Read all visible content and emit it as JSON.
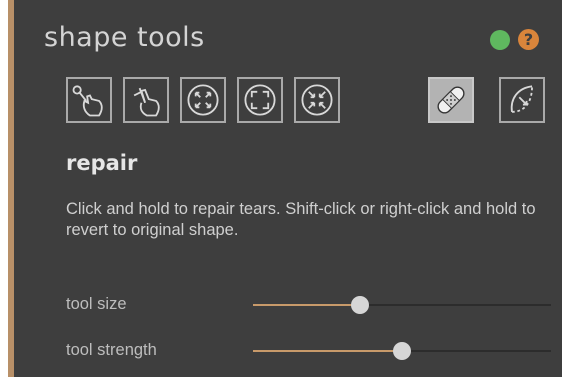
{
  "panel": {
    "title": "shape tools",
    "status_color": "#5fb85f",
    "help_icon": "?",
    "accent_color": "#b89068"
  },
  "tools": [
    {
      "name": "pull-tool-icon",
      "active": false
    },
    {
      "name": "push-tool-icon",
      "active": false
    },
    {
      "name": "expand-tool-icon",
      "active": false
    },
    {
      "name": "expand-all-tool-icon",
      "active": false
    },
    {
      "name": "contract-tool-icon",
      "active": false
    },
    {
      "name": "repair-bandage-tool-icon",
      "active": true
    },
    {
      "name": "warp-tool-icon",
      "active": false
    }
  ],
  "current_tool": {
    "name": "repair",
    "description": "Click and hold to repair tears.  Shift-click or right-click and hold to revert to original shape."
  },
  "sliders": [
    {
      "label": "tool size",
      "value": 0.36
    },
    {
      "label": "tool strength",
      "value": 0.5
    }
  ]
}
